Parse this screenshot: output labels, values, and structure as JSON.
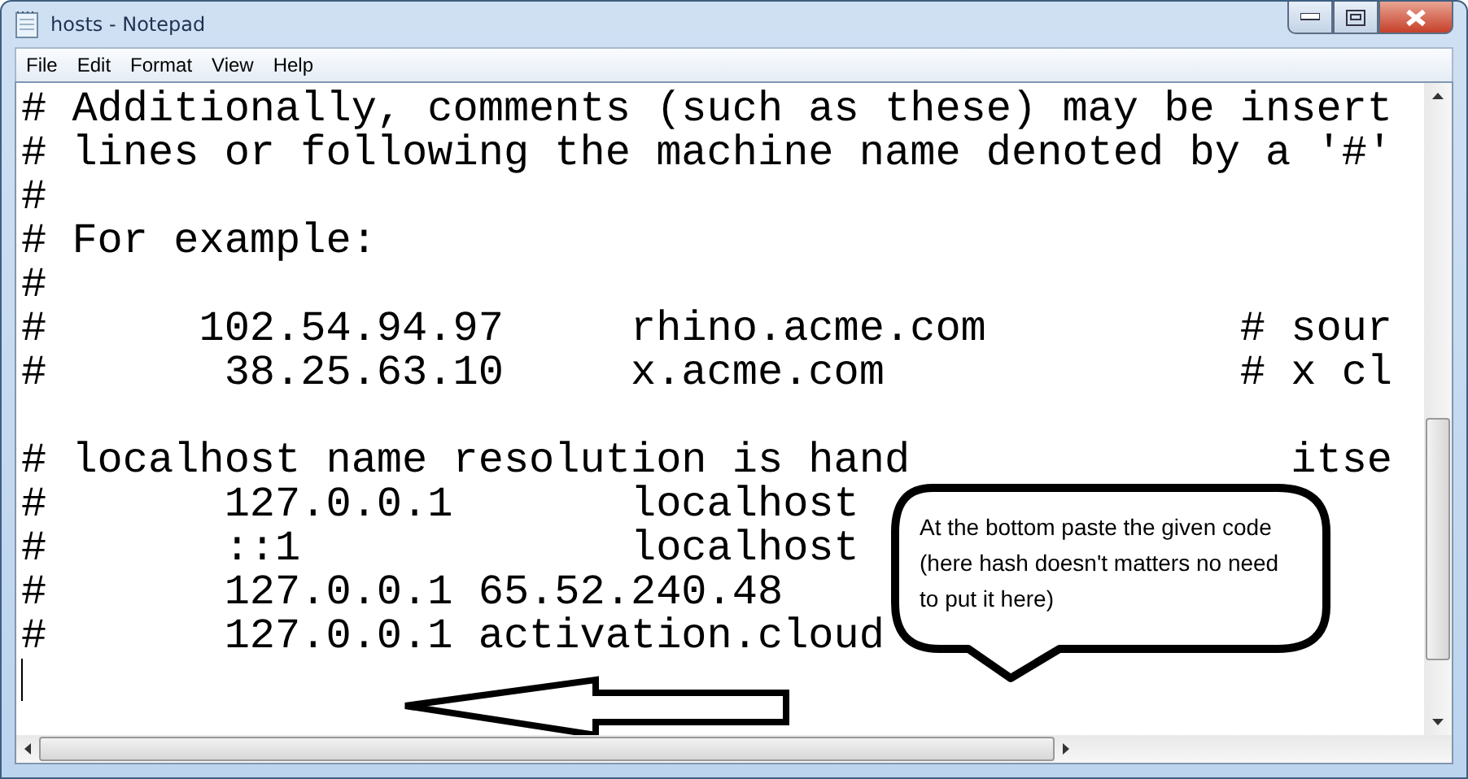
{
  "window": {
    "title": "hosts - Notepad"
  },
  "menu": [
    "File",
    "Edit",
    "Format",
    "View",
    "Help"
  ],
  "editor": {
    "lines": [
      {
        "kind": "text",
        "text": "# Additionally, comments (such as these) may be insert"
      },
      {
        "kind": "text",
        "text": "# lines or following the machine name denoted by a '#'"
      },
      {
        "kind": "text",
        "text": "#"
      },
      {
        "kind": "text",
        "text": "# For example:"
      },
      {
        "kind": "text",
        "text": "#"
      },
      {
        "kind": "text",
        "text": "#      102.54.94.97     rhino.acme.com          # sour"
      },
      {
        "kind": "text",
        "text": "#       38.25.63.10     x.acme.com              # x cl"
      },
      {
        "kind": "blank"
      },
      {
        "kind": "split",
        "text": "# localhost name resolution is hand",
        "tail": "itse"
      },
      {
        "kind": "text",
        "text": "#       127.0.0.1       localhost"
      },
      {
        "kind": "text",
        "text": "#       ::1             localhost"
      },
      {
        "kind": "text",
        "text": "#       127.0.0.1 65.52.240.48"
      },
      {
        "kind": "text",
        "text": "#       127.0.0.1 activation.cloud"
      },
      {
        "kind": "cursor"
      }
    ]
  },
  "callout": {
    "text": "At the bottom paste the given code (here hash doesn't matters no need to put it here)"
  }
}
